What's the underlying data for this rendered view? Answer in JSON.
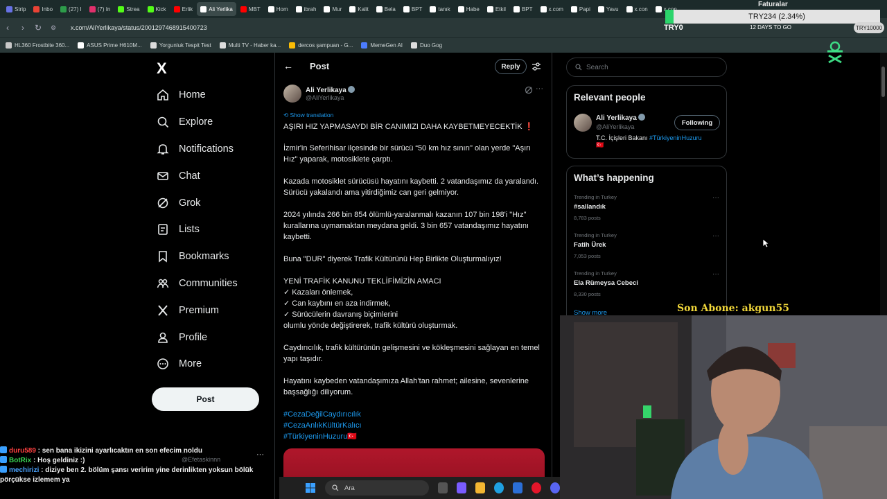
{
  "browser": {
    "tabs": [
      {
        "label": "Strip",
        "color": "#6772e5"
      },
      {
        "label": "Inbo",
        "color": "#ea4335"
      },
      {
        "label": "(27) I",
        "color": "#2d9c4a"
      },
      {
        "label": "(7) In",
        "color": "#e1306c"
      },
      {
        "label": "Strea",
        "color": "#53fc18"
      },
      {
        "label": "Kick",
        "color": "#53fc18"
      },
      {
        "label": "Erlik",
        "color": "#ff0000"
      },
      {
        "label": "Ali Yerlika",
        "color": "#ffffff"
      },
      {
        "label": "MBT",
        "color": "#ff0000"
      },
      {
        "label": "Hom",
        "color": "#ffffff"
      },
      {
        "label": "ibrah",
        "color": "#ffffff"
      },
      {
        "label": "Mur",
        "color": "#ffffff"
      },
      {
        "label": "Kalit",
        "color": "#ffffff"
      },
      {
        "label": "Bela",
        "color": "#ffffff"
      },
      {
        "label": "BPT",
        "color": "#ffffff"
      },
      {
        "label": "tanık",
        "color": "#ffffff"
      },
      {
        "label": "Habe",
        "color": "#ffffff"
      },
      {
        "label": "Etkil",
        "color": "#ffffff"
      },
      {
        "label": "BPT",
        "color": "#ffffff"
      },
      {
        "label": "x.com",
        "color": "#ffffff"
      },
      {
        "label": "Papi",
        "color": "#ffffff"
      },
      {
        "label": "Yavu",
        "color": "#ffffff"
      },
      {
        "label": "x.con",
        "color": "#ffffff"
      },
      {
        "label": "x.con",
        "color": "#ffffff"
      }
    ],
    "active_tab_index": 7,
    "url": "x.com/AliYerlikaya/status/2001297468915400723",
    "bookmarks": [
      {
        "label": "HL360 Frostbite 360...",
        "color": "#c8c8c8"
      },
      {
        "label": "ASUS Prime H610M...",
        "color": "#ffffff"
      },
      {
        "label": "Yorgunluk Tespit Test",
        "color": "#dddddd"
      },
      {
        "label": "Multi TV - Haber ka...",
        "color": "#dddddd"
      },
      {
        "label": "dercos şampuan - G...",
        "color": "#fbbc05"
      },
      {
        "label": "MemeGen AI",
        "color": "#4c7cff"
      },
      {
        "label": "Duo Gog",
        "color": "#dddddd"
      }
    ]
  },
  "ticker": {
    "label": "Faturalar",
    "value": "TRY234 (2.34%)",
    "left": "TRY0",
    "right": "12 DAYS TO GO",
    "badge": "TRY10000"
  },
  "nav": {
    "logo": "X",
    "items": [
      {
        "label": "Home",
        "icon": "home-icon"
      },
      {
        "label": "Explore",
        "icon": "search-icon"
      },
      {
        "label": "Notifications",
        "icon": "bell-icon"
      },
      {
        "label": "Chat",
        "icon": "envelope-icon"
      },
      {
        "label": "Grok",
        "icon": "grok-icon"
      },
      {
        "label": "Lists",
        "icon": "list-icon"
      },
      {
        "label": "Bookmarks",
        "icon": "bookmark-icon"
      },
      {
        "label": "Communities",
        "icon": "communities-icon"
      },
      {
        "label": "Premium",
        "icon": "x-premium-icon"
      },
      {
        "label": "Profile",
        "icon": "person-icon"
      },
      {
        "label": "More",
        "icon": "more-circle-icon"
      }
    ],
    "post_button": "Post",
    "mini_user_name": "...",
    "mini_user_handle": "@Efetaskinnn"
  },
  "post": {
    "header_title": "Post",
    "reply_label": "Reply",
    "author_name": "Ali Yerlikaya",
    "author_handle": "@AliYerlikaya",
    "show_translation": "Show translation",
    "headline": "AŞIRI HIZ YAPMASAYDI BİR CANIMIZI DAHA KAYBETMEYECEKTİK ❗",
    "paragraphs": [
      "İzmir'in Seferihisar ilçesinde bir sürücü “50 km hız sınırı” olan yerde \"Aşırı Hız\" yaparak, motosiklete çarptı.",
      "Kazada motosiklet sürücüsü hayatını kaybetti. 2 vatandaşımız da yaralandı. Sürücü yakalandı ama yitirdiğimiz can geri gelmiyor.",
      "2024 yılında 266 bin 854 ölümlü-yaralanmalı kazanın 107 bin 198'i \"Hız\" kurallarına uymamaktan meydana geldi. 3 bin 657 vatandaşımız hayatını kaybetti.",
      "Buna \"DUR\" diyerek Trafik Kültürünü Hep Birlikte Oluşturmalıyız!"
    ],
    "aims_title": "YENİ TRAFİK KANUNU TEKLİFİMİZİN AMACI",
    "aims": [
      "✓ Kazaları önlemek,",
      "✓ Can kaybını en aza indirmek,",
      "✓ Sürücülerin davranış biçimlerini",
      "olumlu yönde değiştirerek, trafik kültürü oluşturmak."
    ],
    "paragraph_after": "Caydırıcılık, trafik kültürünün gelişmesini ve kökleşmesini sağlayan en temel yapı taşıdır.",
    "closing": "Hayatını kaybeden vatandaşımıza Allah’tan rahmet; ailesine, sevenlerine başsağlığı diliyorum.",
    "hashtags": [
      "#CezaDeğilCaydırıcılık",
      "#CezaAnlıkKültürKalıcı",
      "#TürkiyeninHuzuru🇹🇷"
    ]
  },
  "sidebar": {
    "search_placeholder": "Search",
    "relevant_title": "Relevant people",
    "rp_name": "Ali Yerlikaya",
    "rp_handle": "@AliYerlikaya",
    "rp_bio": "T.C. İçişleri Bakanı",
    "rp_bio_tag": "#TürkiyeninHuzuru",
    "rp_flag": "🇹🇷",
    "following_label": "Following",
    "happening_title": "What’s happening",
    "trends": [
      {
        "context": "Trending in Turkey",
        "name": "#sallandık",
        "count": "8,783 posts"
      },
      {
        "context": "Trending in Turkey",
        "name": "Fatih Ürek",
        "count": "7,053 posts"
      },
      {
        "context": "Trending in Turkey",
        "name": "Ela Rümeysa Cebeci",
        "count": "8,330 posts"
      }
    ],
    "show_more": "Show more"
  },
  "stream": {
    "sub_label": "Son Abone: akgun55",
    "chat": [
      {
        "user": "duru589",
        "sep": " : ",
        "text": "sen bana ikizini ayarlıcaktın en son efecim noldu",
        "kind": "a"
      },
      {
        "user": "BotRix",
        "sep": " : ",
        "text": "Hoş geldiniz :)",
        "kind": "b"
      },
      {
        "user": "mechirizi",
        "sep": " : ",
        "text": "diziye ben 2. bölüm şansı veririm yine derinlikten yoksun bölük",
        "kind": "c"
      },
      {
        "user": "",
        "sep": "",
        "text": "pörçükse izlemem ya",
        "kind": "none"
      }
    ]
  },
  "taskbar": {
    "search_label": "Ara"
  }
}
